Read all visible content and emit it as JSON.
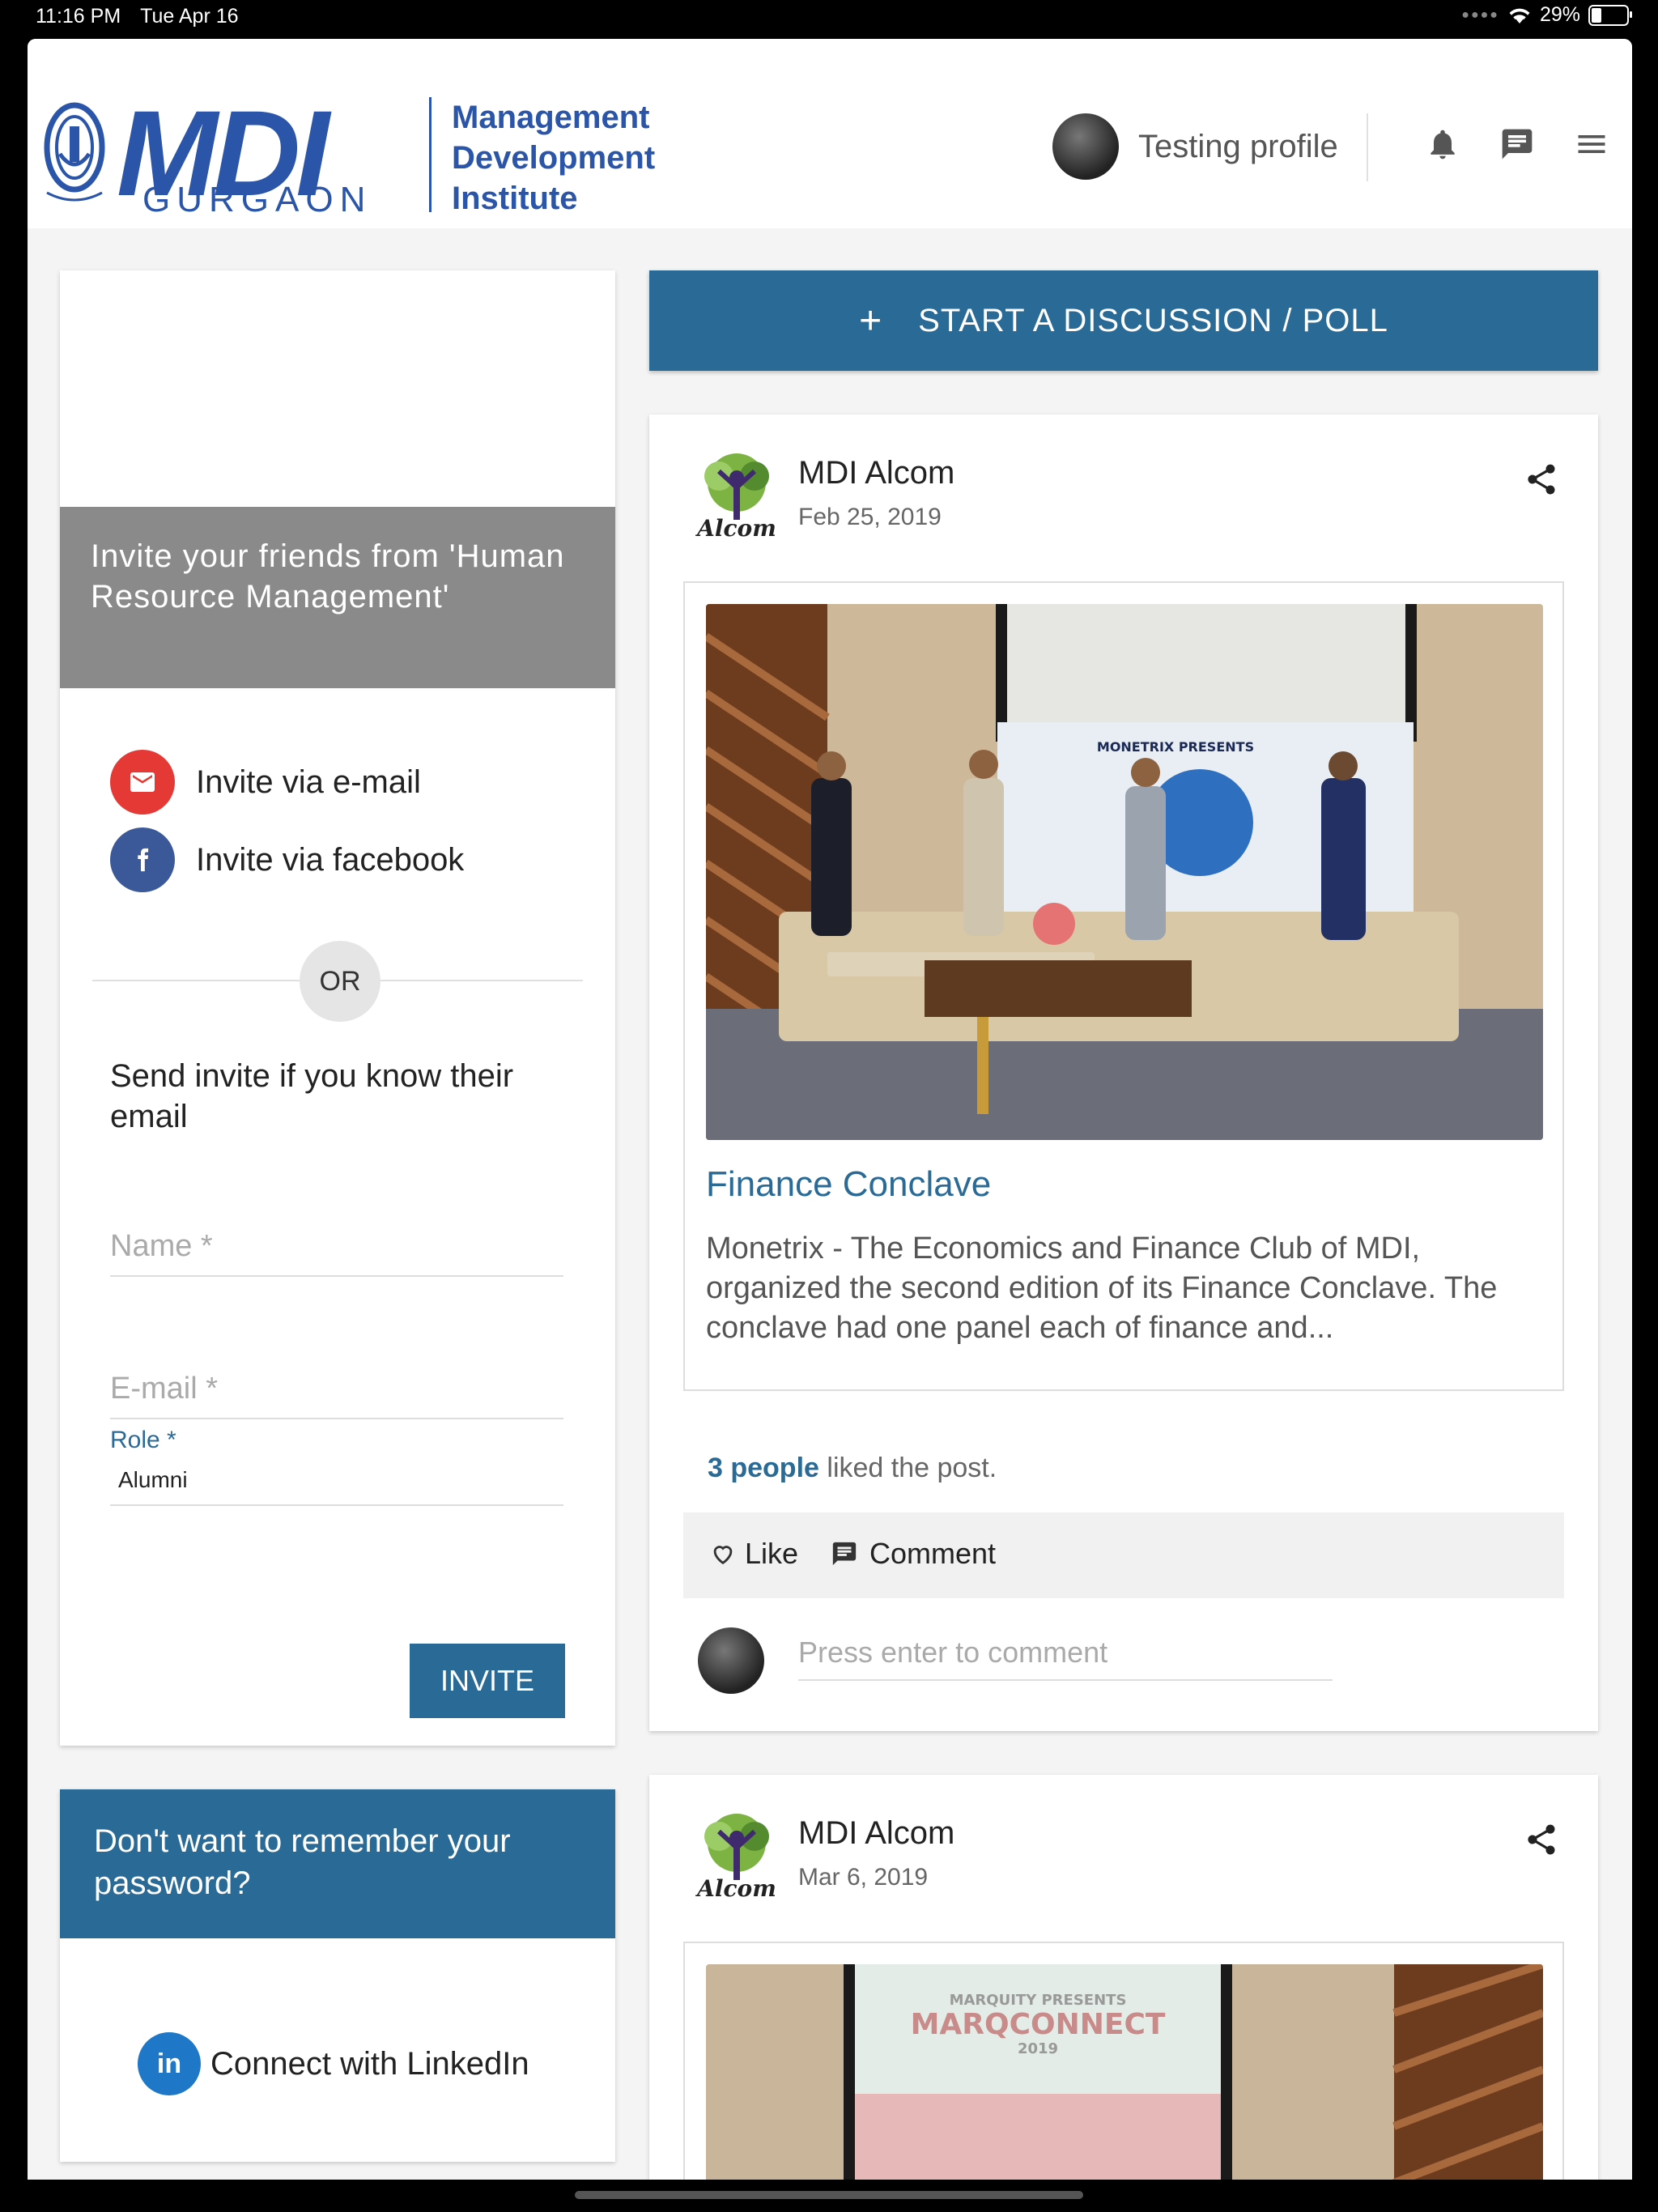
{
  "status_bar": {
    "time": "11:16 PM",
    "date": "Tue Apr 16",
    "battery": "29%",
    "battery_fraction": 0.29
  },
  "header": {
    "logo_word": "MDI",
    "logo_city": "GURGAON",
    "institute_lines": [
      "Management",
      "Development",
      "Institute"
    ],
    "profile_name": "Testing profile",
    "icons": [
      "bell-icon",
      "chat-icon",
      "menu-icon"
    ]
  },
  "invite": {
    "title": "Invite your friends from 'Human Resource Management'",
    "email_option": "Invite via e-mail",
    "facebook_option": "Invite via facebook",
    "or_label": "OR",
    "send_text": "Send invite if you know their email",
    "name_placeholder": "Name *",
    "email_placeholder": "E-mail *",
    "role_label": "Role *",
    "role_value": "Alumni",
    "invite_button": "INVITE"
  },
  "password_card": {
    "title": "Don't want to remember your password?",
    "linkedin_label": "Connect with LinkedIn",
    "linkedin_icon_text": "in"
  },
  "feed": {
    "start_button": "START A DISCUSSION / POLL",
    "start_icon": "+",
    "posts": [
      {
        "author": "MDI Alcom",
        "date": "Feb 25, 2019",
        "title": "Finance Conclave",
        "excerpt": "Monetrix - The Economics and Finance Club of MDI, organized the second edition of its Finance Conclave. The conclave had one panel each of finance and...",
        "banner_text": "MONETRIX PRESENTS",
        "likes_count": "3 people",
        "likes_suffix": " liked the post.",
        "like_label": "Like",
        "comment_label": "Comment",
        "comment_placeholder": "Press enter to comment"
      },
      {
        "author": "MDI Alcom",
        "date": "Mar 6, 2019",
        "screen_text_small": "MARQUITY PRESENTS",
        "screen_text_big": "MARQCONNECT",
        "screen_text_year": "2019"
      }
    ]
  },
  "colors": {
    "primary": "#2a6a96",
    "logo_blue": "#2b55a9",
    "invite_header": "#8a8a8a",
    "gmail_red": "#e53935",
    "facebook_blue": "#3b5998",
    "linkedin_blue": "#1e78c7"
  }
}
